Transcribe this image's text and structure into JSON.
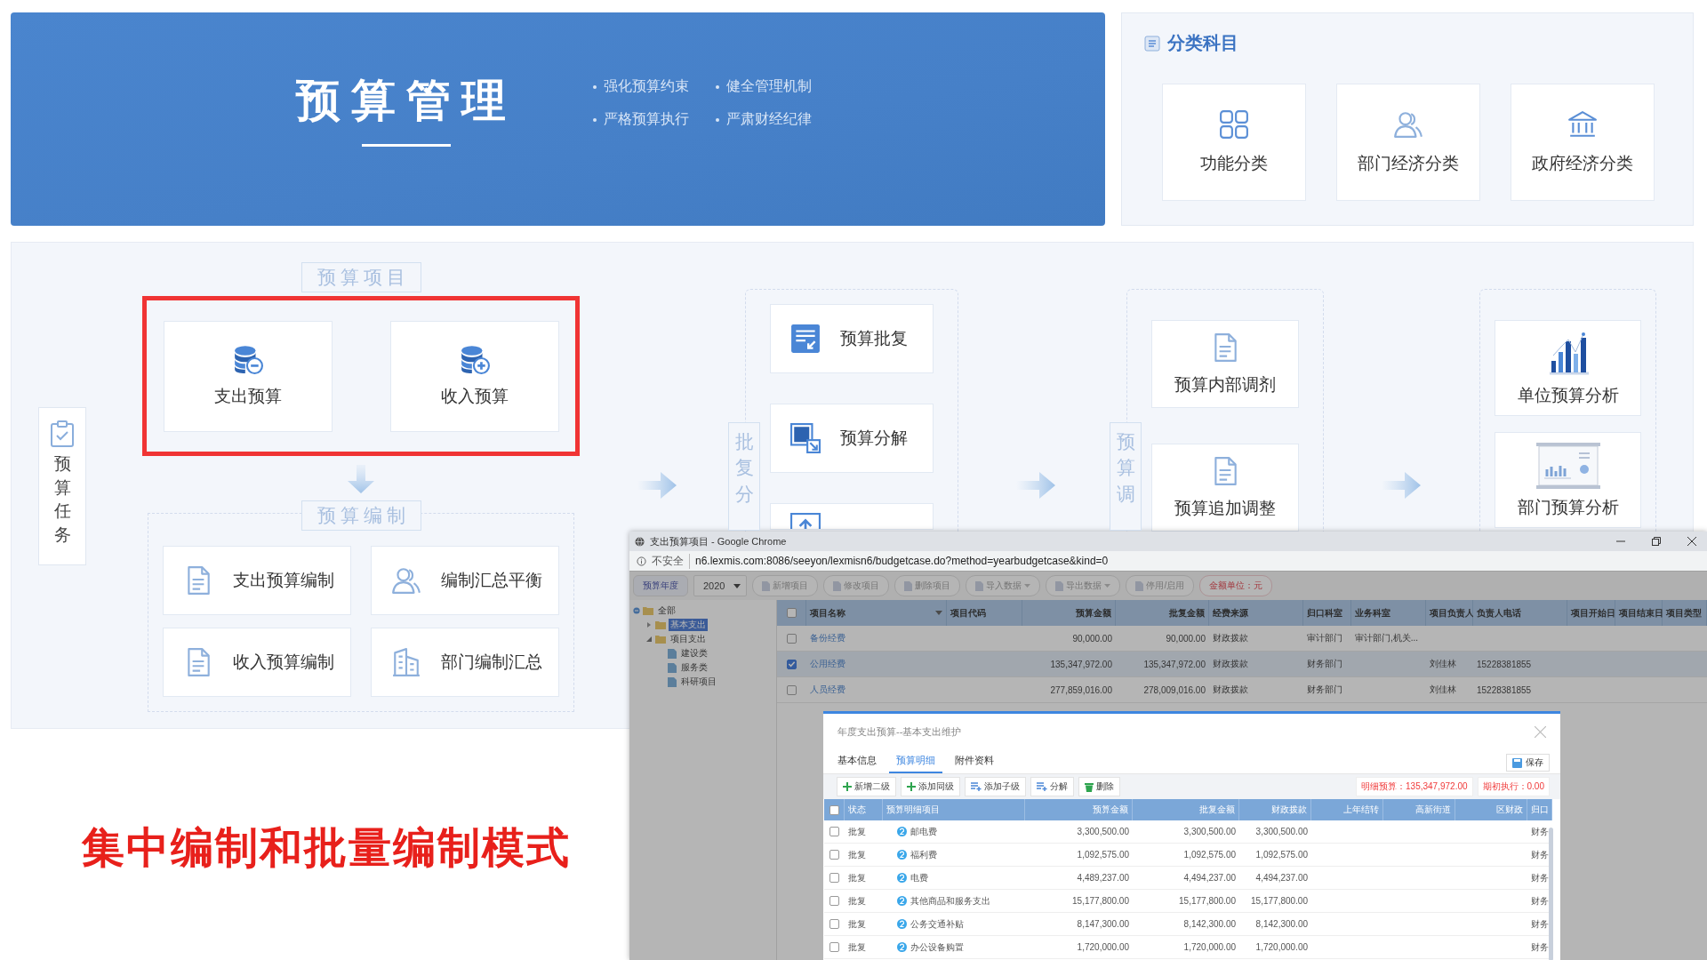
{
  "banner": {
    "title": "预算管理",
    "slogans": [
      "强化预算约束",
      "健全管理机制",
      "严格预算执行",
      "严肃财经纪律"
    ]
  },
  "categories": {
    "title": "分类科目",
    "items": [
      {
        "label": "功能分类",
        "kind": "grid"
      },
      {
        "label": "部门经济分类",
        "kind": "people"
      },
      {
        "label": "政府经济分类",
        "kind": "bank"
      }
    ]
  },
  "flow": {
    "task": {
      "label": "预算任务"
    },
    "projects": {
      "label": "预算项目",
      "highlighted": true,
      "cards": [
        {
          "label": "支出预算",
          "kind": "coins-minus"
        },
        {
          "label": "收入预算",
          "kind": "coins-plus"
        }
      ]
    },
    "compile": {
      "label": "预算编制",
      "cards": [
        {
          "label": "支出预算编制",
          "kind": "doc"
        },
        {
          "label": "编制汇总平衡",
          "kind": "people"
        },
        {
          "label": "收入预算编制",
          "kind": "doc"
        },
        {
          "label": "部门编制汇总",
          "kind": "building"
        }
      ]
    },
    "stages": [
      {
        "label": "批复分",
        "cards": [
          {
            "label": "预算批复",
            "kind": "form"
          },
          {
            "label": "预算分解",
            "kind": "split"
          },
          {
            "kind": "upload"
          }
        ]
      },
      {
        "label": "预算调",
        "cards": [
          {
            "label": "预算内部调剂",
            "kind": "doc-light"
          },
          {
            "label": "预算追加调整",
            "kind": "doc-light"
          }
        ]
      },
      {
        "cards": [
          {
            "label": "单位预算分析",
            "kind": "bars"
          },
          {
            "label": "部门预算分析",
            "kind": "board"
          }
        ]
      }
    ]
  },
  "caption": "集中编制和批量编制模式",
  "browser": {
    "title": "支出预算项目 - Google Chrome",
    "security": "不安全",
    "url": "n6.lexmis.com:8086/seeyon/lexmisn6/budgetcase.do?method=yearbudgetcase&kind=0",
    "toolbar": [
      {
        "label": "预算年度",
        "kind": "primary"
      },
      {
        "label": "2020",
        "kind": "select"
      },
      {
        "label": "新增项目",
        "kind": "button"
      },
      {
        "label": "修改项目",
        "kind": "button"
      },
      {
        "label": "删除项目",
        "kind": "button"
      },
      {
        "label": "导入数据",
        "kind": "dropdown"
      },
      {
        "label": "导出数据",
        "kind": "dropdown"
      },
      {
        "label": "停用/启用",
        "kind": "button"
      },
      {
        "label": "金额单位：元",
        "kind": "note"
      }
    ],
    "tree": [
      {
        "label": "全部",
        "expanded": true,
        "selected": false,
        "children": [
          {
            "label": "基本支出",
            "expanded": false,
            "selected": true
          },
          {
            "label": "项目支出",
            "expanded": true,
            "selected": false,
            "children": [
              {
                "label": "建设类",
                "selected": false
              },
              {
                "label": "服务类",
                "selected": false
              },
              {
                "label": "科研项目",
                "selected": false
              }
            ]
          }
        ]
      }
    ],
    "table": {
      "all_checked": false,
      "columns": [
        {
          "label": "项目名称",
          "dropdown": true
        },
        {
          "label": "项目代码",
          "dropdown": false
        },
        {
          "label": "预算金额",
          "dropdown": false
        },
        {
          "label": "批复金额",
          "dropdown": false
        },
        {
          "label": "经费来源",
          "dropdown": false
        },
        {
          "label": "归口科室",
          "dropdown": false
        },
        {
          "label": "业务科室",
          "dropdown": false
        },
        {
          "label": "项目负责人",
          "dropdown": false
        },
        {
          "label": "负责人电话",
          "dropdown": false
        },
        {
          "label": "项目开始日",
          "dropdown": false
        },
        {
          "label": "项目结束日",
          "dropdown": false
        },
        {
          "label": "项目类型",
          "dropdown": false
        }
      ],
      "rows": [
        {
          "checked": false,
          "selected": false,
          "cells": [
            "备份经费",
            null,
            "90,000.00",
            "90,000.00",
            "财政拨款",
            "审计部门",
            "审计部门,机关...",
            null,
            null,
            null,
            null,
            null
          ]
        },
        {
          "checked": true,
          "selected": true,
          "cells": [
            "公用经费",
            null,
            "135,347,972.00",
            "135,347,972.00",
            "财政拨款",
            "财务部门",
            null,
            "刘佳林",
            "15228381855",
            null,
            null,
            null
          ]
        },
        {
          "checked": false,
          "selected": false,
          "cells": [
            "人员经费",
            null,
            "277,859,016.00",
            "278,009,016.00",
            "财政拨款",
            "财务部门",
            null,
            "刘佳林",
            "15228381855",
            null,
            null,
            null
          ]
        }
      ]
    },
    "dialog": {
      "title": "年度支出预算--基本支出维护",
      "tabs": [
        {
          "label": "基本信息",
          "selected": false
        },
        {
          "label": "预算明细",
          "selected": true
        },
        {
          "label": "附件资料",
          "selected": false
        }
      ],
      "save": "保存",
      "toolbar": [
        {
          "label": "新增二级",
          "kind": "add"
        },
        {
          "label": "添加同级",
          "kind": "add"
        },
        {
          "label": "添加子级",
          "kind": "list-add"
        },
        {
          "label": "分解",
          "kind": "list-add"
        },
        {
          "label": "删除",
          "kind": "delete"
        }
      ],
      "totals": [
        "明细预算：135,347,972.00",
        "期初执行：0.00"
      ],
      "all_checked": false,
      "columns": [
        "状态",
        "预算明细项目",
        "预算金额",
        "批复金额",
        "财政拨款",
        "上年结转",
        "高新街道",
        "区财政",
        "归口"
      ],
      "rows": [
        {
          "checked": false,
          "cells": [
            "批复",
            "邮电费",
            "3,300,500.00",
            "3,300,500.00",
            "3,300,500.00",
            null,
            null,
            null,
            "财务"
          ]
        },
        {
          "checked": false,
          "cells": [
            "批复",
            "福利费",
            "1,092,575.00",
            "1,092,575.00",
            "1,092,575.00",
            null,
            null,
            null,
            "财务"
          ]
        },
        {
          "checked": false,
          "cells": [
            "批复",
            "电费",
            "4,489,237.00",
            "4,494,237.00",
            "4,494,237.00",
            null,
            null,
            null,
            "财务"
          ]
        },
        {
          "checked": false,
          "cells": [
            "批复",
            "其他商品和服务支出",
            "15,177,800.00",
            "15,177,800.00",
            "15,177,800.00",
            null,
            null,
            null,
            "财务"
          ]
        },
        {
          "checked": false,
          "cells": [
            "批复",
            "公务交通补贴",
            "8,147,300.00",
            "8,142,300.00",
            "8,142,300.00",
            null,
            null,
            null,
            "财务"
          ]
        },
        {
          "checked": false,
          "cells": [
            "批复",
            "办公设备购置",
            "1,720,000.00",
            "1,720,000.00",
            "1,720,000.00",
            null,
            null,
            null,
            "财务"
          ]
        }
      ]
    }
  }
}
